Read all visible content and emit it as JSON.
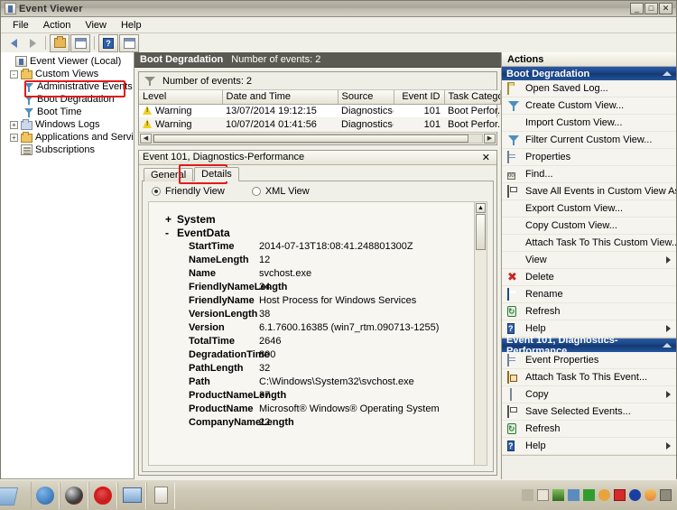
{
  "window": {
    "title": "Event Viewer",
    "icon": "event-viewer-icon",
    "buttons": {
      "minimize": "_",
      "maximize": "□",
      "close": "✕"
    }
  },
  "menubar": {
    "items": [
      "File",
      "Action",
      "View",
      "Help"
    ]
  },
  "toolbar": {
    "items": [
      {
        "name": "back-button",
        "icon": "back-arrow-icon"
      },
      {
        "name": "forward-button",
        "icon": "forward-arrow-icon"
      },
      {
        "name": "up-folder-button",
        "icon": "folder-up-icon"
      },
      {
        "name": "show-hide-tree-button",
        "icon": "tree-pane-icon"
      },
      {
        "name": "help-button",
        "icon": "help-icon",
        "glyph": "?"
      },
      {
        "name": "show-hide-actions-button",
        "icon": "actions-pane-icon"
      }
    ]
  },
  "tree": {
    "nodes": [
      {
        "label": "Event Viewer (Local)",
        "indent": 0,
        "expander": "",
        "icon": "event-viewer-icon",
        "selected": false
      },
      {
        "label": "Custom Views",
        "indent": 1,
        "expander": "-",
        "icon": "folder-icon",
        "selected": false
      },
      {
        "label": "Administrative Events",
        "indent": 2,
        "expander": "",
        "icon": "funnel-icon",
        "selected": false
      },
      {
        "label": "Boot Degradation",
        "indent": 2,
        "expander": "",
        "icon": "funnel-icon",
        "selected": true
      },
      {
        "label": "Boot Time",
        "indent": 2,
        "expander": "",
        "icon": "funnel-icon",
        "selected": false
      },
      {
        "label": "Windows Logs",
        "indent": 1,
        "expander": "+",
        "icon": "folder-blue-icon",
        "selected": false
      },
      {
        "label": "Applications and Services Logs",
        "indent": 1,
        "expander": "+",
        "icon": "folder-icon",
        "selected": false
      },
      {
        "label": "Subscriptions",
        "indent": 1,
        "expander": "",
        "icon": "subscriptions-icon",
        "selected": false
      }
    ],
    "highlight": "Boot Degradation"
  },
  "content": {
    "header_title": "Boot Degradation",
    "header_count": "Number of events: 2",
    "filter_label": "Number of events: 2",
    "columns": [
      "Level",
      "Date and Time",
      "Source",
      "Event ID",
      "Task Category"
    ],
    "rows": [
      {
        "level": "Warning",
        "datetime": "13/07/2014 19:12:15",
        "source": "Diagnostics-...",
        "event_id": "101",
        "task_category": "Boot Perfor..."
      },
      {
        "level": "Warning",
        "datetime": "10/07/2014 01:41:56",
        "source": "Diagnostics-...",
        "event_id": "101",
        "task_category": "Boot Perfor..."
      }
    ]
  },
  "detail": {
    "title": "Event 101, Diagnostics-Performance",
    "close_label": "✕",
    "tabs": [
      {
        "label": "General",
        "active": false
      },
      {
        "label": "Details",
        "active": true,
        "highlighted": true
      }
    ],
    "view_modes": [
      {
        "label": "Friendly View",
        "selected": true
      },
      {
        "label": "XML View",
        "selected": false
      }
    ],
    "sections": [
      {
        "sign": "+",
        "name": "System",
        "expanded": false
      },
      {
        "sign": "-",
        "name": "EventData",
        "expanded": true
      }
    ],
    "fields": [
      {
        "name": "StartTime",
        "value": "2014-07-13T18:08:41.248801300Z"
      },
      {
        "name": "NameLength",
        "value": "12"
      },
      {
        "name": "Name",
        "value": "svchost.exe"
      },
      {
        "name": "FriendlyNameLength",
        "value": "34"
      },
      {
        "name": "FriendlyName",
        "value": "Host Process for Windows Services"
      },
      {
        "name": "VersionLength",
        "value": "38"
      },
      {
        "name": "Version",
        "value": "6.1.7600.16385 (win7_rtm.090713-1255)"
      },
      {
        "name": "TotalTime",
        "value": "2646"
      },
      {
        "name": "DegradationTime",
        "value": "800"
      },
      {
        "name": "PathLength",
        "value": "32"
      },
      {
        "name": "Path",
        "value": "C:\\Windows\\System32\\svchost.exe"
      },
      {
        "name": "ProductNameLength",
        "value": "37"
      },
      {
        "name": "ProductName",
        "value": "Microsoft® Windows® Operating System"
      },
      {
        "name": "CompanyNameLength",
        "value": "22"
      }
    ]
  },
  "actions": {
    "header": "Actions",
    "groups": [
      {
        "title": "Boot Degradation",
        "items": [
          {
            "label": "Open Saved Log...",
            "icon": "open-log-icon",
            "submenu": false
          },
          {
            "label": "Create Custom View...",
            "icon": "funnel-icon",
            "submenu": false
          },
          {
            "label": "Import Custom View...",
            "icon": "none",
            "submenu": false
          },
          {
            "label": "Filter Current Custom View...",
            "icon": "funnel-icon",
            "submenu": false
          },
          {
            "label": "Properties",
            "icon": "properties-icon",
            "submenu": false
          },
          {
            "label": "Find...",
            "icon": "find-icon",
            "submenu": false
          },
          {
            "label": "Save All Events in Custom View As...",
            "icon": "save-icon",
            "submenu": false
          },
          {
            "label": "Export Custom View...",
            "icon": "none",
            "submenu": false
          },
          {
            "label": "Copy Custom View...",
            "icon": "none",
            "submenu": false
          },
          {
            "label": "Attach Task To This Custom View...",
            "icon": "none",
            "submenu": false
          },
          {
            "label": "View",
            "icon": "none",
            "submenu": true
          },
          {
            "label": "Delete",
            "icon": "delete-icon",
            "submenu": false
          },
          {
            "label": "Rename",
            "icon": "rename-icon",
            "submenu": false
          },
          {
            "label": "Refresh",
            "icon": "refresh-icon",
            "submenu": false
          },
          {
            "label": "Help",
            "icon": "help-icon",
            "submenu": true
          }
        ]
      },
      {
        "title": "Event 101, Diagnostics-Performance",
        "items": [
          {
            "label": "Event Properties",
            "icon": "properties-icon",
            "submenu": false
          },
          {
            "label": "Attach Task To This Event...",
            "icon": "attach-task-icon",
            "submenu": false
          },
          {
            "label": "Copy",
            "icon": "copy-icon",
            "submenu": true
          },
          {
            "label": "Save Selected Events...",
            "icon": "save-icon",
            "submenu": false
          },
          {
            "label": "Refresh",
            "icon": "refresh-icon",
            "submenu": false
          },
          {
            "label": "Help",
            "icon": "help-icon",
            "submenu": true
          }
        ]
      }
    ]
  },
  "taskbar": {
    "quick_launch": [
      {
        "name": "thunderbird-icon",
        "color": "#2f6fb5"
      },
      {
        "name": "browser-icon",
        "color": "#c0392b"
      },
      {
        "name": "opera-icon",
        "color": "#d41b1b"
      },
      {
        "name": "remote-desktop-icon",
        "color": "#4c86c6"
      },
      {
        "name": "event-viewer-task-icon",
        "color": "#c8c4b5"
      }
    ],
    "tray": [
      {
        "name": "lock-icon",
        "color": "#b9b3a2"
      },
      {
        "name": "windows-icon",
        "color": "#e8e5d8"
      },
      {
        "name": "map-icon",
        "color": "#4f8b3c"
      },
      {
        "name": "network-icon",
        "color": "#5a8cc0"
      },
      {
        "name": "green-square-icon",
        "color": "#2f9e2f"
      },
      {
        "name": "package-icon",
        "color": "#e8a33d"
      },
      {
        "name": "red-app-icon",
        "color": "#d42b2b"
      },
      {
        "name": "blue-circle-icon",
        "color": "#1b3fa0"
      },
      {
        "name": "flame-icon",
        "color": "#e8853d"
      },
      {
        "name": "screen-icon",
        "color": "#8e8b7d"
      }
    ]
  },
  "colors": {
    "accent_blue": "#1d4f9b",
    "highlight_red": "#e01b1b",
    "header_dark": "#5a5a52",
    "warning_yellow": "#f2d022"
  }
}
